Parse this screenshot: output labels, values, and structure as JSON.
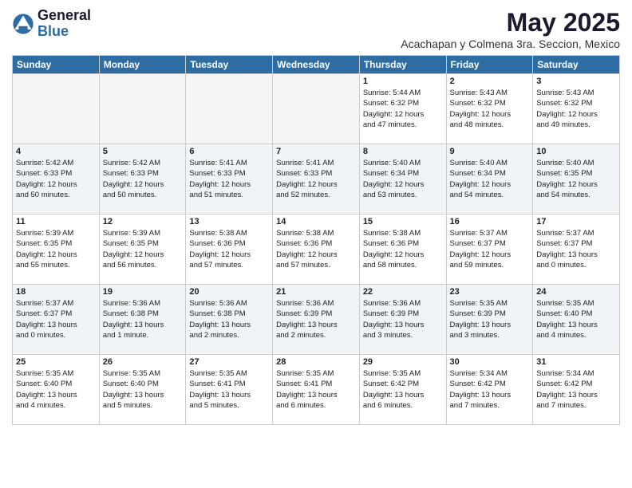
{
  "header": {
    "logo_general": "General",
    "logo_blue": "Blue",
    "month": "May 2025",
    "location": "Acachapan y Colmena 3ra. Seccion, Mexico"
  },
  "days_of_week": [
    "Sunday",
    "Monday",
    "Tuesday",
    "Wednesday",
    "Thursday",
    "Friday",
    "Saturday"
  ],
  "weeks": [
    [
      {
        "day": "",
        "info": ""
      },
      {
        "day": "",
        "info": ""
      },
      {
        "day": "",
        "info": ""
      },
      {
        "day": "",
        "info": ""
      },
      {
        "day": "1",
        "info": "Sunrise: 5:44 AM\nSunset: 6:32 PM\nDaylight: 12 hours\nand 47 minutes."
      },
      {
        "day": "2",
        "info": "Sunrise: 5:43 AM\nSunset: 6:32 PM\nDaylight: 12 hours\nand 48 minutes."
      },
      {
        "day": "3",
        "info": "Sunrise: 5:43 AM\nSunset: 6:32 PM\nDaylight: 12 hours\nand 49 minutes."
      }
    ],
    [
      {
        "day": "4",
        "info": "Sunrise: 5:42 AM\nSunset: 6:33 PM\nDaylight: 12 hours\nand 50 minutes."
      },
      {
        "day": "5",
        "info": "Sunrise: 5:42 AM\nSunset: 6:33 PM\nDaylight: 12 hours\nand 50 minutes."
      },
      {
        "day": "6",
        "info": "Sunrise: 5:41 AM\nSunset: 6:33 PM\nDaylight: 12 hours\nand 51 minutes."
      },
      {
        "day": "7",
        "info": "Sunrise: 5:41 AM\nSunset: 6:33 PM\nDaylight: 12 hours\nand 52 minutes."
      },
      {
        "day": "8",
        "info": "Sunrise: 5:40 AM\nSunset: 6:34 PM\nDaylight: 12 hours\nand 53 minutes."
      },
      {
        "day": "9",
        "info": "Sunrise: 5:40 AM\nSunset: 6:34 PM\nDaylight: 12 hours\nand 54 minutes."
      },
      {
        "day": "10",
        "info": "Sunrise: 5:40 AM\nSunset: 6:35 PM\nDaylight: 12 hours\nand 54 minutes."
      }
    ],
    [
      {
        "day": "11",
        "info": "Sunrise: 5:39 AM\nSunset: 6:35 PM\nDaylight: 12 hours\nand 55 minutes."
      },
      {
        "day": "12",
        "info": "Sunrise: 5:39 AM\nSunset: 6:35 PM\nDaylight: 12 hours\nand 56 minutes."
      },
      {
        "day": "13",
        "info": "Sunrise: 5:38 AM\nSunset: 6:36 PM\nDaylight: 12 hours\nand 57 minutes."
      },
      {
        "day": "14",
        "info": "Sunrise: 5:38 AM\nSunset: 6:36 PM\nDaylight: 12 hours\nand 57 minutes."
      },
      {
        "day": "15",
        "info": "Sunrise: 5:38 AM\nSunset: 6:36 PM\nDaylight: 12 hours\nand 58 minutes."
      },
      {
        "day": "16",
        "info": "Sunrise: 5:37 AM\nSunset: 6:37 PM\nDaylight: 12 hours\nand 59 minutes."
      },
      {
        "day": "17",
        "info": "Sunrise: 5:37 AM\nSunset: 6:37 PM\nDaylight: 13 hours\nand 0 minutes."
      }
    ],
    [
      {
        "day": "18",
        "info": "Sunrise: 5:37 AM\nSunset: 6:37 PM\nDaylight: 13 hours\nand 0 minutes."
      },
      {
        "day": "19",
        "info": "Sunrise: 5:36 AM\nSunset: 6:38 PM\nDaylight: 13 hours\nand 1 minute."
      },
      {
        "day": "20",
        "info": "Sunrise: 5:36 AM\nSunset: 6:38 PM\nDaylight: 13 hours\nand 2 minutes."
      },
      {
        "day": "21",
        "info": "Sunrise: 5:36 AM\nSunset: 6:39 PM\nDaylight: 13 hours\nand 2 minutes."
      },
      {
        "day": "22",
        "info": "Sunrise: 5:36 AM\nSunset: 6:39 PM\nDaylight: 13 hours\nand 3 minutes."
      },
      {
        "day": "23",
        "info": "Sunrise: 5:35 AM\nSunset: 6:39 PM\nDaylight: 13 hours\nand 3 minutes."
      },
      {
        "day": "24",
        "info": "Sunrise: 5:35 AM\nSunset: 6:40 PM\nDaylight: 13 hours\nand 4 minutes."
      }
    ],
    [
      {
        "day": "25",
        "info": "Sunrise: 5:35 AM\nSunset: 6:40 PM\nDaylight: 13 hours\nand 4 minutes."
      },
      {
        "day": "26",
        "info": "Sunrise: 5:35 AM\nSunset: 6:40 PM\nDaylight: 13 hours\nand 5 minutes."
      },
      {
        "day": "27",
        "info": "Sunrise: 5:35 AM\nSunset: 6:41 PM\nDaylight: 13 hours\nand 5 minutes."
      },
      {
        "day": "28",
        "info": "Sunrise: 5:35 AM\nSunset: 6:41 PM\nDaylight: 13 hours\nand 6 minutes."
      },
      {
        "day": "29",
        "info": "Sunrise: 5:35 AM\nSunset: 6:42 PM\nDaylight: 13 hours\nand 6 minutes."
      },
      {
        "day": "30",
        "info": "Sunrise: 5:34 AM\nSunset: 6:42 PM\nDaylight: 13 hours\nand 7 minutes."
      },
      {
        "day": "31",
        "info": "Sunrise: 5:34 AM\nSunset: 6:42 PM\nDaylight: 13 hours\nand 7 minutes."
      }
    ]
  ]
}
